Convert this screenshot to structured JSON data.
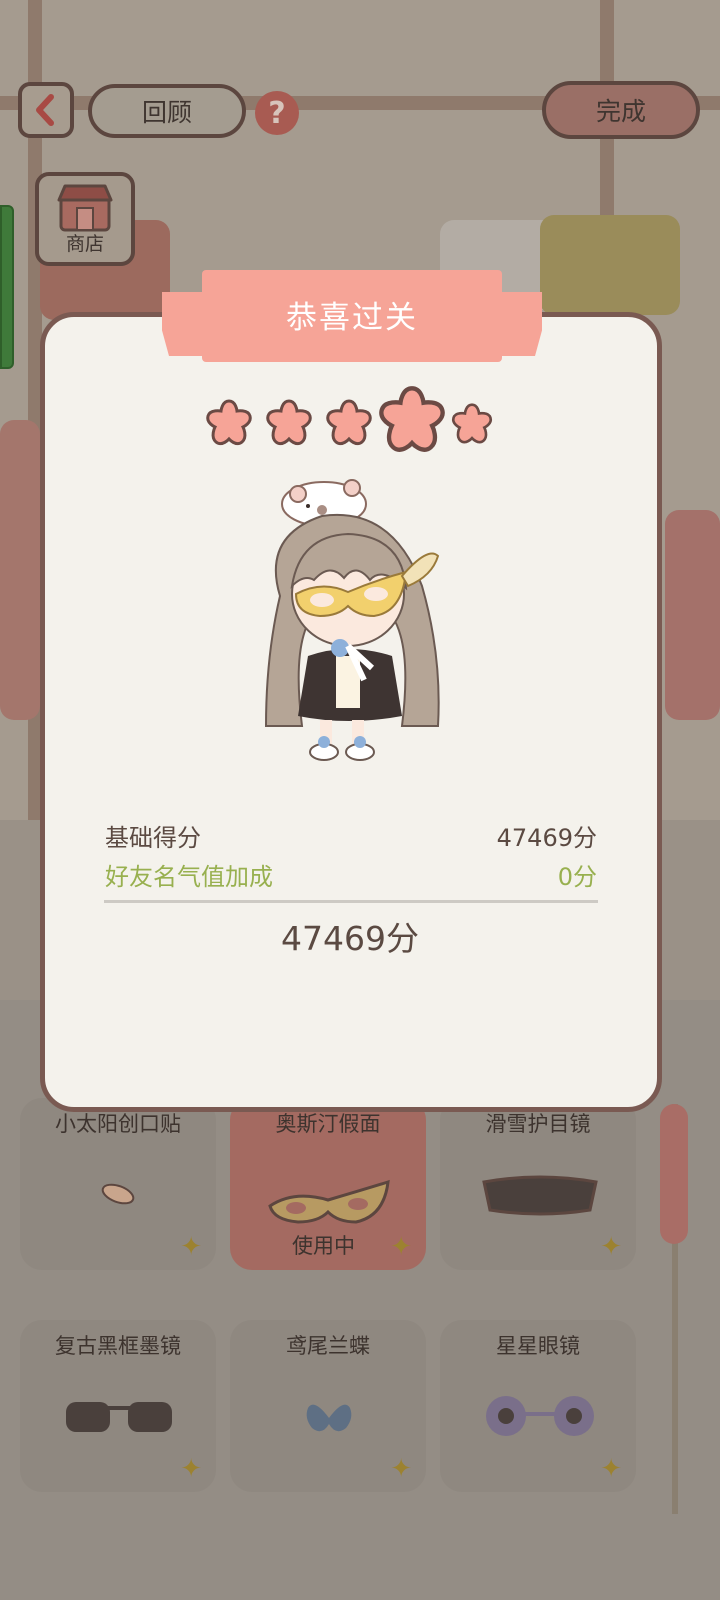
{
  "topbar": {
    "review_label": "回顾",
    "help_symbol": "?",
    "done_label": "完成",
    "shop_label": "商店"
  },
  "dialog": {
    "title": "恭喜过关",
    "stars_total": 5,
    "stars_earned": 5,
    "rows": [
      {
        "label": "基础得分",
        "value": "47469分"
      },
      {
        "label": "好友名气值加成",
        "value": "0分"
      }
    ],
    "total": "47469分"
  },
  "items": [
    {
      "name": "小太阳创口贴",
      "star": "✦"
    },
    {
      "name": "奥斯汀假面",
      "star": "✦",
      "status": "使用中"
    },
    {
      "name": "滑雪护目镜",
      "star": "✦"
    },
    {
      "name": "复古黑框墨镜",
      "star": "✦"
    },
    {
      "name": "鸢尾兰蝶",
      "star": "✦"
    },
    {
      "name": "星星眼镜",
      "star": "✦"
    }
  ],
  "colors": {
    "accent": "#f6a497",
    "bonus_green": "#98b04f",
    "text_brown": "#5b4a42"
  }
}
